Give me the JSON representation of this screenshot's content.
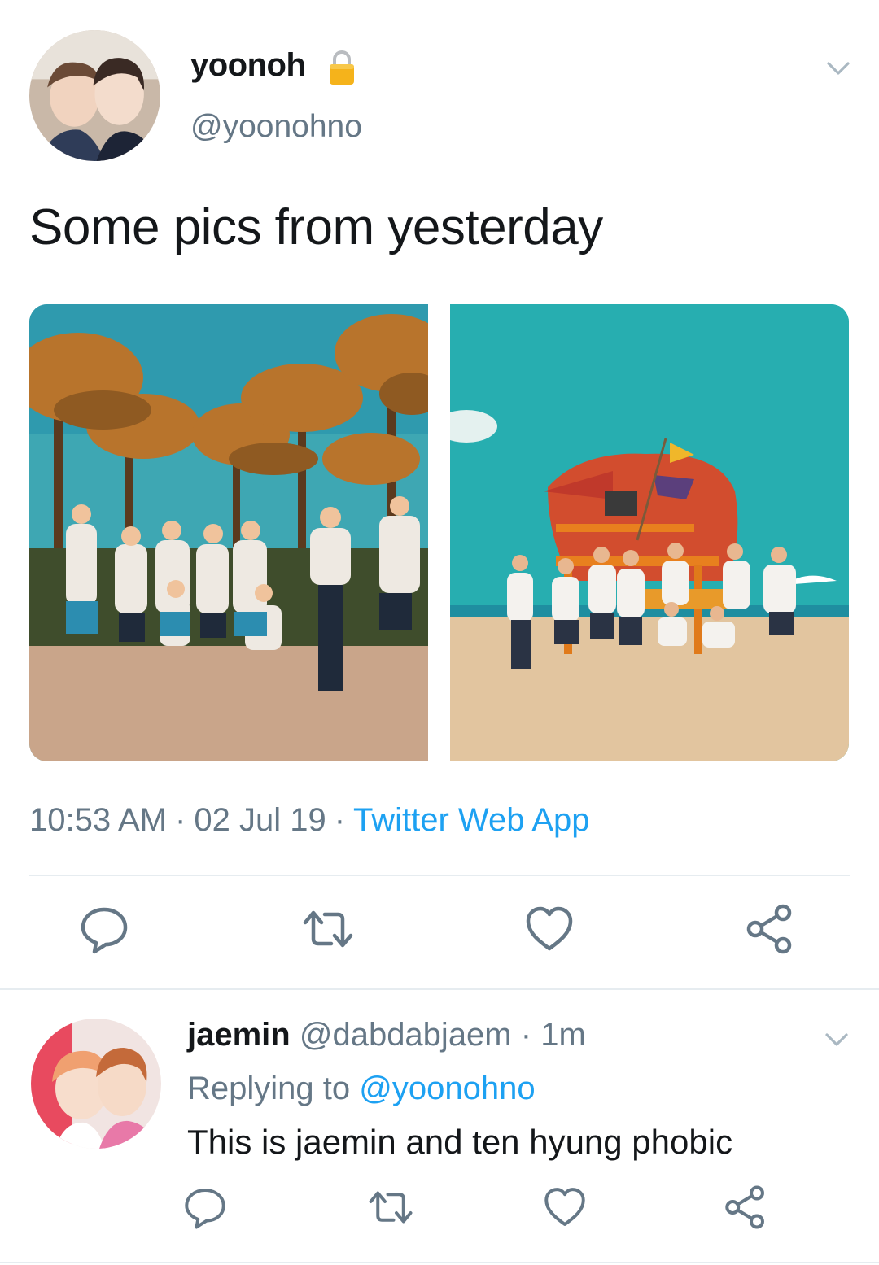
{
  "tweet": {
    "display_name": "yoonoh",
    "handle": "@yoonohno",
    "text": "Some pics from yesterday",
    "time": "10:53 AM",
    "date": "02 Jul 19",
    "source": "Twitter Web App",
    "separator": "·",
    "photos": [
      "palm-trees-group-photo",
      "lifeguard-tower-beach-photo"
    ]
  },
  "reply": {
    "display_name": "jaemin",
    "handle": "@dabdabjaem",
    "separator": "·",
    "age": "1m",
    "replying_prefix": "Replying to",
    "replying_to": "@yoonohno",
    "text": "This is jaemin and ten hyung phobic"
  },
  "icons": {
    "lock": "lock-icon",
    "chevron": "chevron-down-icon",
    "reply": "reply-icon",
    "retweet": "retweet-icon",
    "like": "heart-icon",
    "share": "share-icon"
  },
  "colors": {
    "link": "#1da1f2",
    "secondary_text": "#657786",
    "primary_text": "#14171a",
    "divider": "#e6ecf0"
  }
}
